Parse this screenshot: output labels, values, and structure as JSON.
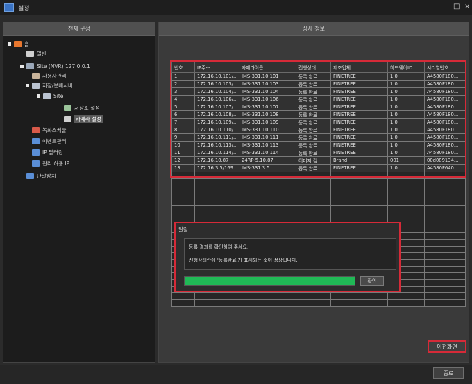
{
  "window": {
    "title": "설정",
    "maximize_glyph": "□",
    "close_glyph": "×"
  },
  "left_panel": {
    "title": "전체 구성",
    "tree": [
      {
        "label": "홈",
        "level": 0,
        "icon": "home-icon",
        "icon_color": "#e8772e",
        "toggle": true
      },
      {
        "label": "일반",
        "level": 1,
        "icon": "gear-icon",
        "icon_color": "#cfcfcf",
        "toggle": false
      },
      {
        "label": "Site (NVR) 127.0.0.1",
        "level": 1,
        "icon": "server-icon",
        "icon_color": "#9aa7b8",
        "toggle": true
      },
      {
        "label": "사용자관리",
        "level": 2,
        "icon": "user-icon",
        "icon_color": "#c9b39a",
        "toggle": false
      },
      {
        "label": "저장/분배서버",
        "level": 2,
        "icon": "storage-server-icon",
        "icon_color": "#b9c2cf",
        "toggle": true
      },
      {
        "label": "Site",
        "level": 3,
        "icon": "site-icon",
        "icon_color": "#b9c2cf",
        "toggle": true
      },
      {
        "label": "저장소 설정",
        "level": 4,
        "icon": "storage-settings-icon",
        "icon_color": "#9bc49a",
        "toggle": false
      },
      {
        "label": "카메라 설정",
        "level": 4,
        "icon": "camera-settings-icon",
        "icon_color": "#cfcfcf",
        "toggle": false,
        "selected": true
      },
      {
        "label": "녹화스케줄",
        "level": 2,
        "icon": "record-schedule-icon",
        "icon_color": "#d85a4a",
        "toggle": false
      },
      {
        "label": "이벤트관리",
        "level": 2,
        "icon": "event-icon",
        "icon_color": "#5a8ed6",
        "toggle": false
      },
      {
        "label": "IP 필터링",
        "level": 2,
        "icon": "ip-filter-icon",
        "icon_color": "#5a8ed6",
        "toggle": false
      },
      {
        "label": "관리 허용 IP",
        "level": 2,
        "icon": "allowed-ip-icon",
        "icon_color": "#5a8ed6",
        "toggle": false
      },
      {
        "label": "단말장치",
        "level": 1,
        "icon": "terminal-device-icon",
        "icon_color": "#5a8ed6",
        "toggle": false
      }
    ]
  },
  "right_panel": {
    "title": "상세 정보",
    "table": {
      "headers": [
        "번호",
        "IP주소",
        "카메라이름",
        "진행상태",
        "제조업체",
        "하드웨어ID",
        "시리얼번호"
      ],
      "rows": [
        [
          "1",
          "172.16.10.101/...",
          "IMS-331.10.101",
          "등록 완료",
          "FINETREE",
          "1.0",
          "A4580F180..."
        ],
        [
          "2",
          "172.16.10.103/...",
          "IMS-331.10.103",
          "등록 완료",
          "FINETREE",
          "1.0",
          "A4580F180..."
        ],
        [
          "3",
          "172.16.10.104/...",
          "IMS-331.10.104",
          "등록 완료",
          "FINETREE",
          "1.0",
          "A4580F180..."
        ],
        [
          "4",
          "172.16.10.106/...",
          "IMS-331.10.106",
          "등록 완료",
          "FINETREE",
          "1.0",
          "A4580F180..."
        ],
        [
          "5",
          "172.16.10.107/...",
          "IMS-331.10.107",
          "등록 완료",
          "FINETREE",
          "1.0",
          "A4580F180..."
        ],
        [
          "6",
          "172.16.10.108/...",
          "IMS-331.10.108",
          "등록 완료",
          "FINETREE",
          "1.0",
          "A4580F180..."
        ],
        [
          "7",
          "172.16.10.109/...",
          "IMS-331.10.109",
          "등록 완료",
          "FINETREE",
          "1.0",
          "A4580F180..."
        ],
        [
          "8",
          "172.16.10.110/...",
          "IMS-331.10.110",
          "등록 완료",
          "FINETREE",
          "1.0",
          "A4580F180..."
        ],
        [
          "9",
          "172.16.10.111/...",
          "IMS-331.10.111",
          "등록 완료",
          "FINETREE",
          "1.0",
          "A4580F180..."
        ],
        [
          "10",
          "172.16.10.113/...",
          "IMS-331.10.113",
          "등록 완료",
          "FINETREE",
          "1.0",
          "A4580F180..."
        ],
        [
          "11",
          "172.16.10.114/...",
          "IMS-331.10.114",
          "등록 완료",
          "FINETREE",
          "1.0",
          "A4580F180..."
        ],
        [
          "12",
          "172.16.10.87",
          "24RP-5.10.87",
          "이미지 검...",
          "Brand",
          "001",
          "00d089134..."
        ],
        [
          "13",
          "172.16.3.5/169....",
          "IMS-331.3.5",
          "등록 완료",
          "FINETREE",
          "1.0",
          "A4580F640..."
        ]
      ],
      "empty_row_count": 20
    },
    "dialog": {
      "title": "알림",
      "message_1": "등록 결과를 확인하여 주세요.",
      "message_2": "진행상태란에 '등록완료'가 표시되는 것이 정상입니다.",
      "progress_fraction": 1.0,
      "ok_label": "확인"
    },
    "prev_button_label": "이전화면"
  },
  "footer": {
    "close_label": "종료"
  },
  "colors": {
    "highlight": "#d62a38",
    "progress": "#20b956",
    "background": "#2b2b2b"
  }
}
